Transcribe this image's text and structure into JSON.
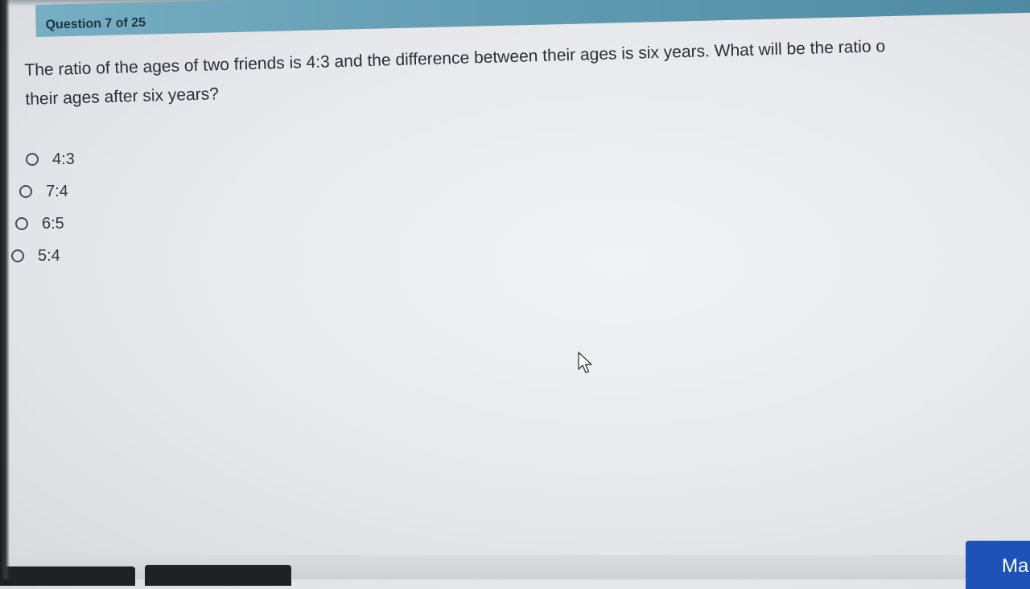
{
  "header": {
    "question_counter": "Question 7 of 25",
    "accent_color": "#5f99af"
  },
  "question": {
    "line1": "The ratio of the ages of two friends is 4:3 and the difference between their ages is six years. What will be the ratio o",
    "line2": "their ages after six years?"
  },
  "options": [
    {
      "label": "4:3",
      "selected": false
    },
    {
      "label": "7:4",
      "selected": false
    },
    {
      "label": "6:5",
      "selected": false
    },
    {
      "label": "5:4",
      "selected": false
    }
  ],
  "footer": {
    "mark_label": "Ma",
    "mark_color": "#1f52b8"
  },
  "icons": {
    "cursor": "mouse-pointer-icon",
    "radio": "radio-unchecked-icon"
  }
}
